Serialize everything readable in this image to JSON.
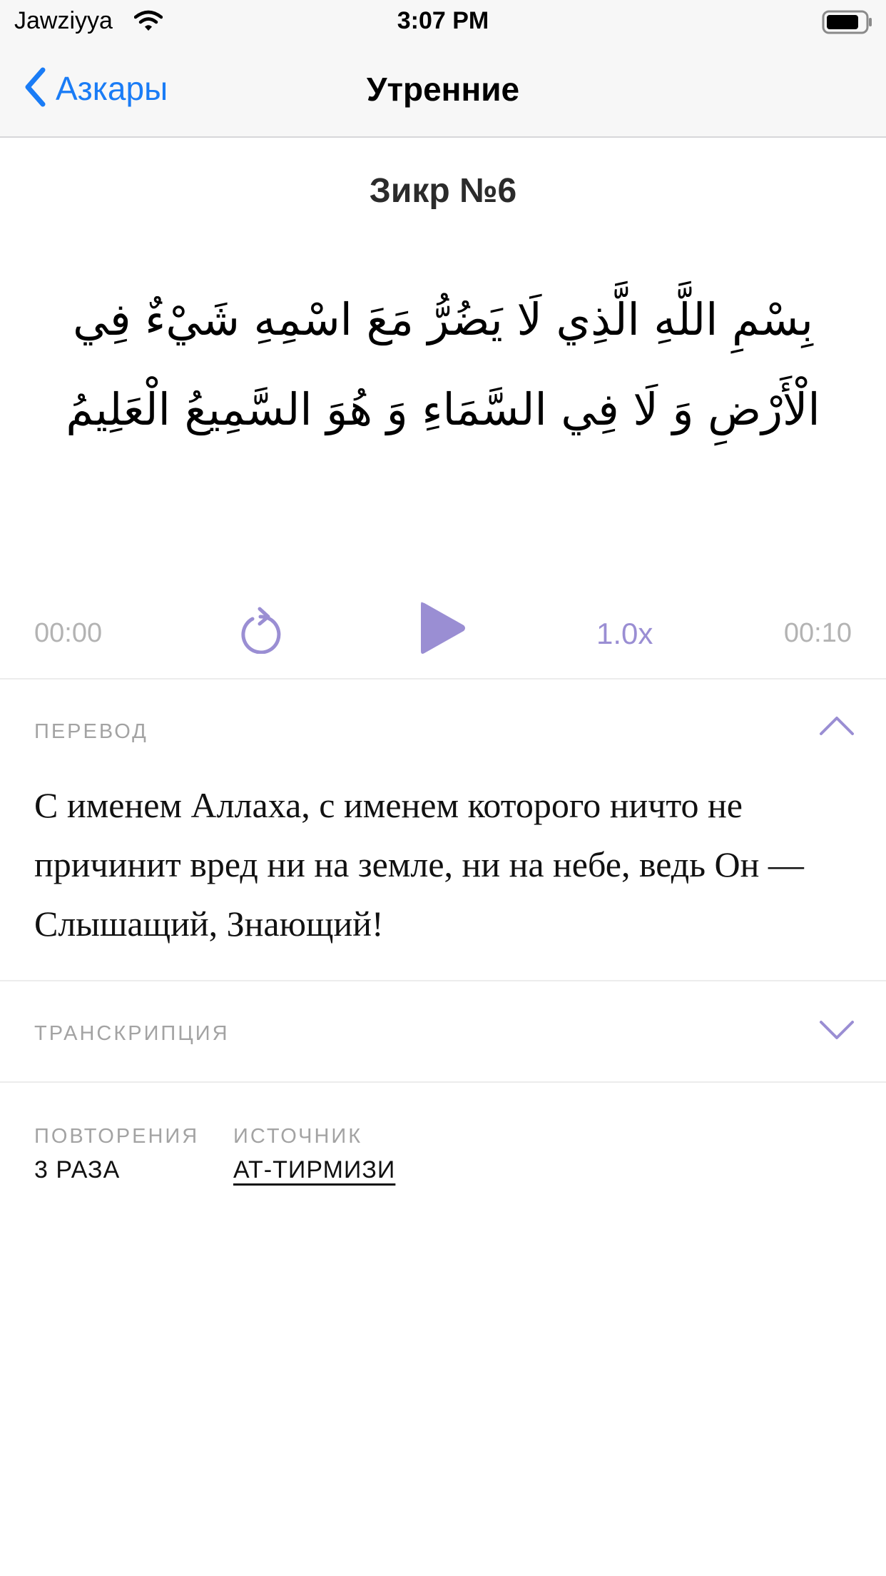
{
  "status_bar": {
    "carrier": "Jawziyya",
    "time": "3:07 PM",
    "icons": [
      "wifi-icon",
      "battery-icon"
    ]
  },
  "nav": {
    "back_label": "Азкары",
    "title": "Утренние"
  },
  "zikr": {
    "title": "Зикр №6",
    "arabic": "بِسْمِ اللَّهِ الَّذِي لَا يَضُرُّ مَعَ اسْمِهِ شَيْءٌ فِي الْأَرْضِ وَ لَا فِي السَّمَاءِ وَ هُوَ السَّمِيعُ الْعَلِيمُ"
  },
  "player": {
    "current_time": "00:00",
    "duration": "00:10",
    "speed": "1.0x",
    "accent_color": "#9a8ed3"
  },
  "translation": {
    "label": "ПЕРЕВОД",
    "text": "С именем Аллаха, с именем которого ничто не причинит вред ни на земле, ни на небе, ведь Он — Слышащий, Знающий!",
    "expanded": true
  },
  "transcription": {
    "label": "ТРАНСКРИПЦИЯ",
    "expanded": false
  },
  "meta": {
    "repeats_label": "ПОВТОРЕНИЯ",
    "repeats_value": "3 РАЗА",
    "source_label": "ИСТОЧНИК",
    "source_value": "АТ-ТИРМИЗИ"
  },
  "colors": {
    "nav_blue": "#1a7cf6",
    "accent_purple": "#9a8ed3",
    "label_gray": "#a3a3a3"
  }
}
